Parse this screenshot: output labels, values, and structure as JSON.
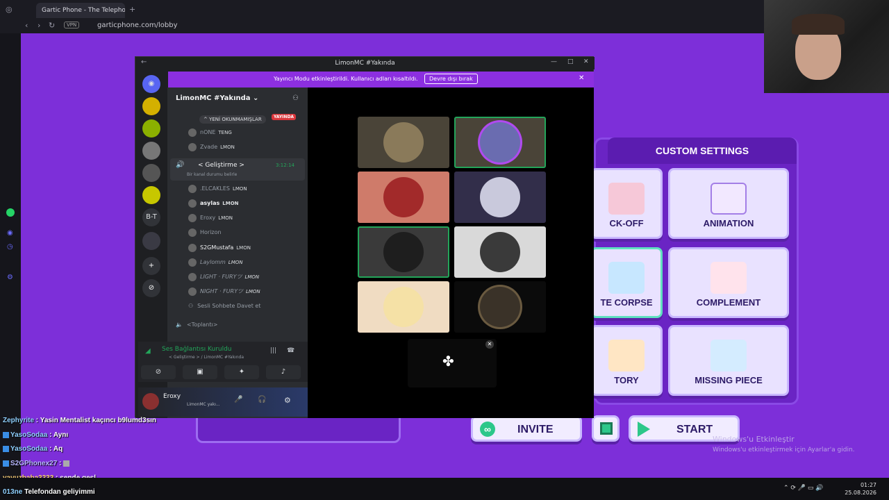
{
  "browser": {
    "tab_title": "Gartic Phone - The Telephone",
    "url": "garticphone.com/lobby",
    "vpn_label": "VPN"
  },
  "game": {
    "custom_settings_label": "CUSTOM SETTINGS",
    "modes": [
      {
        "label": "CK-OFF"
      },
      {
        "label": "ANIMATION"
      },
      {
        "label": "TE CORPSE"
      },
      {
        "label": "COMPLEMENT"
      },
      {
        "label": "TORY"
      },
      {
        "label": "MISSING PIECE"
      }
    ],
    "invite_label": "INVITE",
    "start_label": "START",
    "accent": "#7d2fd9"
  },
  "windows_watermark": {
    "line1": "Windows'u Etkinleştir",
    "line2": "Windows'u etkinleştirmek için Ayarlar'a gidin."
  },
  "discord": {
    "window_title": "LimonMC #Yakında",
    "banner_text": "Yayıncı Modu etkinleştirildi. Kullanıcı adları kısaltıldı.",
    "banner_button": "Devre dışı bırak",
    "server_name": "LimonMC #Yakında",
    "server_initials": "B-T",
    "unread_label": "YENİ OKUNMAMIŞLAR",
    "live_badge": "YAYINDA",
    "members_top": [
      {
        "name": "nONE",
        "tag": "TENG"
      },
      {
        "name": "Zvade",
        "tag": "LMON"
      }
    ],
    "active_channel": {
      "name": "< Geliştirme >",
      "time": "3:12:14",
      "status": "Bir kanal durumu belirle"
    },
    "members": [
      {
        "name": ".ELCAKLES",
        "tag": "LMON"
      },
      {
        "name": "asylas",
        "tag": "LMON"
      },
      {
        "name": "Eroxy",
        "tag": "LMON"
      },
      {
        "name": "Horizon",
        "tag": ""
      },
      {
        "name": "S2GMustafa",
        "tag": "LMON"
      },
      {
        "name": "Laylomm",
        "tag": "LMON"
      },
      {
        "name": "LIGHT · FURYツ",
        "tag": "LMON"
      },
      {
        "name": "NIGHT · FURYツ",
        "tag": "LMON"
      }
    ],
    "invite_voice": "Sesli Sohbete Davet et",
    "other_channel": "<Toplantı>",
    "voice_status": "Ses Bağlantısı Kuruldu",
    "voice_sub": "< Geliştirme > / LimonMC #Yakında",
    "user": {
      "name": "Eroxy",
      "sub": "LimonMC yakı..."
    }
  },
  "chat": [
    {
      "user": "Zephyrite",
      "text": "Yasin Mentalist kaçıncı b9lumd3sın"
    },
    {
      "user": "YasoSodaa",
      "text": "Aynı"
    },
    {
      "user": "YasoSodaa",
      "text": "Aq"
    },
    {
      "user": "S2GPhonex27",
      "text": ""
    },
    {
      "user": "yavuzbaba3333",
      "text": "sende geşl"
    },
    {
      "user": "013ne",
      "text": "Telefondan geliyimmi"
    }
  ],
  "taskbar": {
    "time": "01:27",
    "date": "25.08.2026"
  }
}
